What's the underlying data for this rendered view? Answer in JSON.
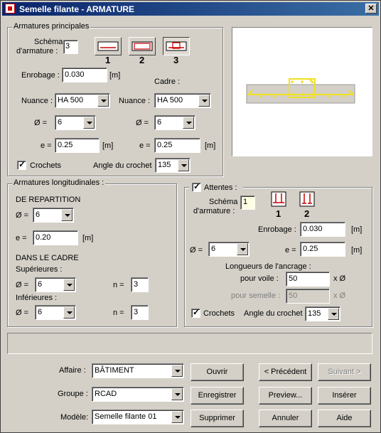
{
  "window": {
    "title": "Semelle filante - ARMATURE",
    "close": "✕"
  },
  "principales": {
    "title": "Armatures principales",
    "schema_label_1": "Schéma",
    "schema_label_2": "d'armature :",
    "schema_value": "3",
    "schema_options": [
      "1",
      "2",
      "3"
    ],
    "enrobage_label": "Enrobage :",
    "enrobage_value": "0.030",
    "enrobage_unit": "[m]",
    "cadre_label": "Cadre :",
    "nuance_label": "Nuance :",
    "nuance_value": "HA 500",
    "cadre_nuance_label": "Nuance :",
    "cadre_nuance_value": "HA 500",
    "diam_label": "Ø =",
    "diam_value": "6",
    "cadre_diam_label": "Ø =",
    "cadre_diam_value": "6",
    "e_label": "e =",
    "e_value": "0.25",
    "e_unit": "[m]",
    "cadre_e_label": "e =",
    "cadre_e_value": "0.25",
    "cadre_e_unit": "[m]",
    "crochets_label": "Crochets",
    "crochets_checked": true,
    "angle_label": "Angle du crochet",
    "angle_value": "135"
  },
  "longitudinales": {
    "title": "Armatures longitudinales :",
    "repartition_label": "DE REPARTITION",
    "rep_diam_label": "Ø =",
    "rep_diam_value": "6",
    "rep_e_label": "e =",
    "rep_e_value": "0.20",
    "rep_e_unit": "[m]",
    "cadre_label": "DANS LE CADRE",
    "sup_label": "Supérieures :",
    "sup_diam_label": "Ø =",
    "sup_diam_value": "6",
    "sup_n_label": "n =",
    "sup_n_value": "3",
    "inf_label": "Inférieures :",
    "inf_diam_label": "Ø =",
    "inf_diam_value": "6",
    "inf_n_label": "n =",
    "inf_n_value": "3"
  },
  "attentes": {
    "title": "Attentes :",
    "checked": true,
    "schema_label_1": "Schéma",
    "schema_label_2": "d'armature :",
    "schema_value": "1",
    "schema_options": [
      "1",
      "2"
    ],
    "enrobage_label": "Enrobage :",
    "enrobage_value": "0.030",
    "enrobage_unit": "[m]",
    "diam_label": "Ø =",
    "diam_value": "6",
    "e_label": "e =",
    "e_value": "0.25",
    "e_unit": "[m]",
    "ancrage_label": "Longueurs de l'ancrage :",
    "voile_label": "pour voile :",
    "voile_value": "50",
    "voile_unit": "x Ø",
    "semelle_label": "pour semelle :",
    "semelle_value": "50",
    "semelle_unit": "x Ø",
    "crochets_label": "Crochets",
    "crochets_checked": true,
    "angle_label": "Angle du crochet",
    "angle_value": "135"
  },
  "footer": {
    "affaire_label": "Affaire :",
    "affaire_value": "BÂTIMENT",
    "groupe_label": "Groupe :",
    "groupe_value": "RCAD",
    "modele_label": "Modèle:",
    "modele_value": "Semelle filante 01",
    "ouvrir": "Ouvrir",
    "enregistrer": "Enregistrer",
    "supprimer": "Supprimer",
    "precedent": "< Précédent",
    "suivant": "Suivant >",
    "preview": "Preview...",
    "inserer": "Insérer",
    "annuler": "Annuler",
    "aide": "Aide"
  },
  "colors": {
    "title_start": "#0a246a",
    "title_end": "#3a6ea5",
    "rebar": "#f0e020",
    "face": "#d4d0c8"
  }
}
